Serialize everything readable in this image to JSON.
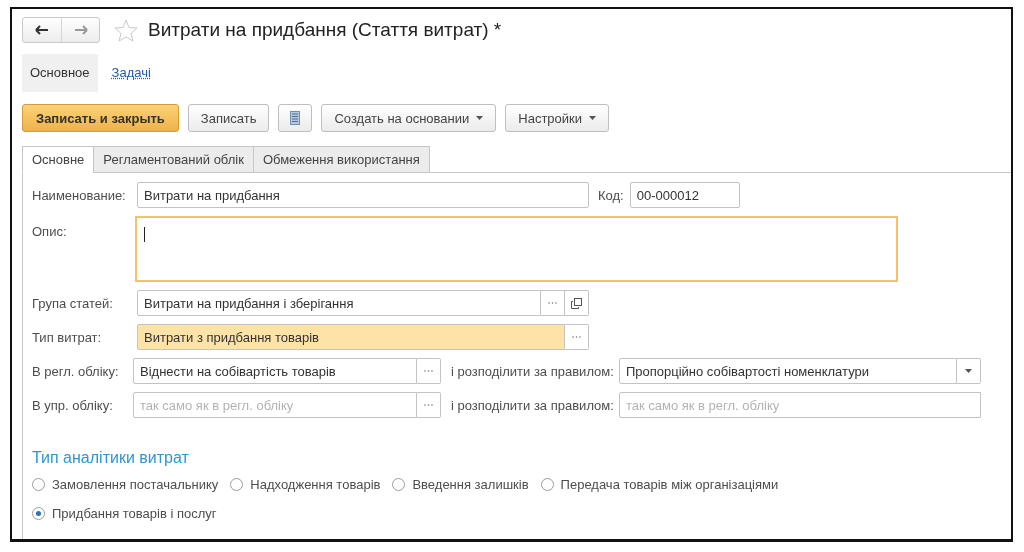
{
  "window": {
    "title": "Витрати на придбання (Стаття витрат) *",
    "favorite": false
  },
  "sections": [
    {
      "label": "Основное",
      "selected": true
    },
    {
      "label": "Задачі",
      "selected": false
    }
  ],
  "toolbar": [
    {
      "kind": "primary",
      "label": "Записать и закрыть"
    },
    {
      "kind": "default",
      "label": "Записать"
    },
    {
      "kind": "icon"
    },
    {
      "kind": "menu",
      "label": "Создать на основании"
    },
    {
      "kind": "menu",
      "label": "Настройки"
    }
  ],
  "tabs": [
    {
      "label": "Основне",
      "selected": true
    },
    {
      "label": "Регламентований облік",
      "selected": false
    },
    {
      "label": "Обмеження використання",
      "selected": false
    }
  ],
  "name_field": {
    "label": "Наименование:",
    "value": "Витрати на придбання"
  },
  "code_field": {
    "label": "Код:",
    "value": "00-000012"
  },
  "description_field": {
    "label": "Опис:",
    "focused": true
  },
  "group_field": {
    "label": "Група статей:",
    "value": "Витрати на придбання і зберігання",
    "highlighted": false
  },
  "type_field": {
    "label": "Тип витрат:",
    "value": "Витрати з придбання товарів",
    "highlighted": true
  },
  "accounting_rows": [
    {
      "label": "В регл. обліку:",
      "value": "Віднести на собівартість товарів",
      "rule_label": "і розподілити за правилом:",
      "rule_value": "Пропорційно собівартості номенклатури",
      "rule_dropdown": true
    },
    {
      "label": "В упр. обліку:",
      "placeholder": "так само як в регл. обліку",
      "rule_label": "і розподілити за правилом:",
      "rule_placeholder": "так само як в регл. обліку",
      "rule_dropdown": false
    }
  ],
  "analytics": {
    "title": "Тип аналітики витрат",
    "options": [
      {
        "label": "Замовлення постачальнику",
        "selected": false
      },
      {
        "label": "Надходження товарів",
        "selected": false
      },
      {
        "label": "Введення залишків",
        "selected": false
      },
      {
        "label": "Передача товарів між організаціями",
        "selected": false
      },
      {
        "label": "Придбання товарів і послуг",
        "selected": true
      }
    ]
  }
}
